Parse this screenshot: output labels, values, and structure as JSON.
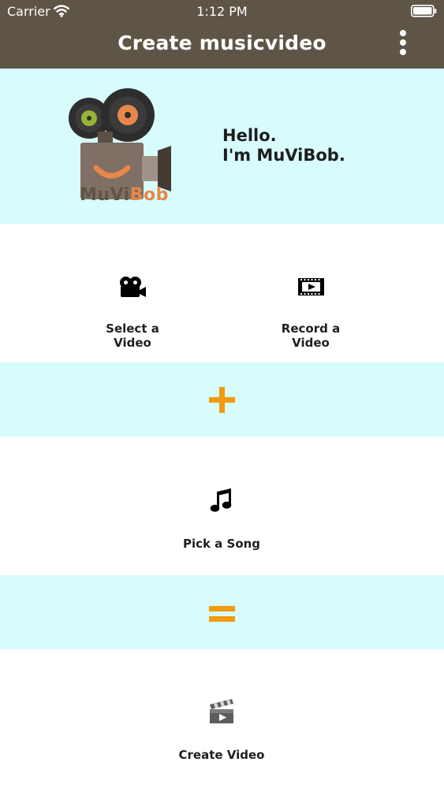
{
  "status_bar": {
    "carrier": "Carrier",
    "time": "1:12 PM",
    "wifi_icon": "wifi-icon",
    "battery_icon": "battery-icon"
  },
  "nav": {
    "title": "Create musicvideo",
    "menu_icon": "vertical-ellipsis-icon"
  },
  "hero": {
    "greeting_line1": "Hello.",
    "greeting_line2": "I'm MuViBob.",
    "logo_text_part1": "MuVi",
    "logo_text_part2": "Bob",
    "logo_icon": "camera-mascot-logo"
  },
  "actions": {
    "select_video": {
      "label": "Select a Video",
      "icon": "movie-camera-icon"
    },
    "record_video": {
      "label": "Record a Video",
      "icon": "film-strip-play-icon"
    },
    "pick_song": {
      "label": "Pick a Song",
      "icon": "music-note-icon"
    },
    "create_video": {
      "label": "Create Video",
      "icon": "clapperboard-play-icon"
    }
  },
  "operators": {
    "plus_icon": "plus-icon",
    "equals_icon": "equals-icon"
  },
  "colors": {
    "topbar": "#5f5547",
    "band": "#d8fbfc",
    "accent": "#f29a10",
    "logo_orange": "#e7874a"
  }
}
